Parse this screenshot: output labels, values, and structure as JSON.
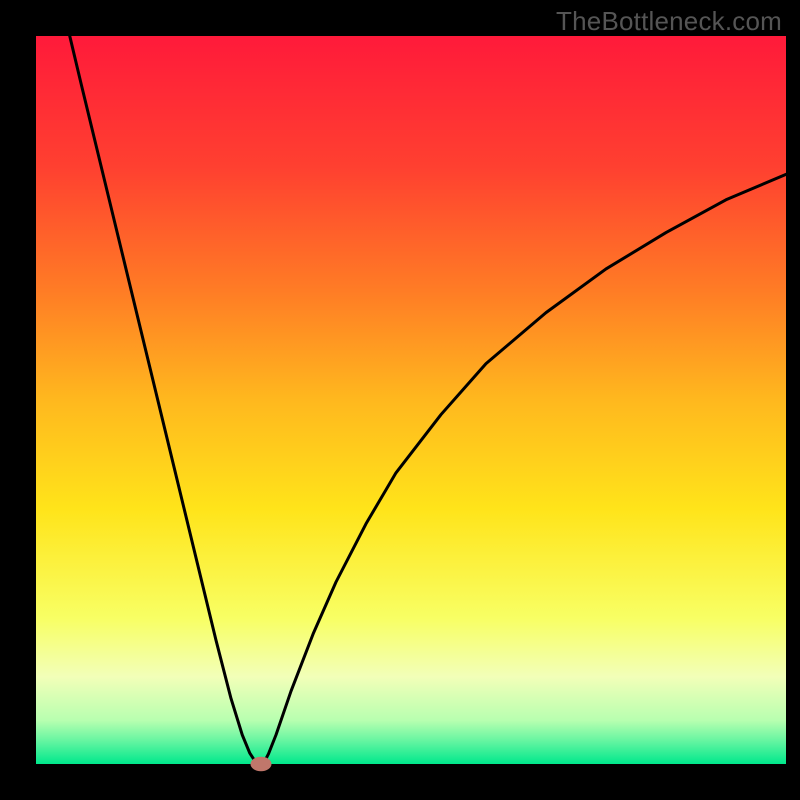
{
  "watermark": "TheBottleneck.com",
  "chart_data": {
    "type": "line",
    "title": "",
    "xlabel": "",
    "ylabel": "",
    "xlim": [
      0,
      100
    ],
    "ylim": [
      0,
      100
    ],
    "grid": false,
    "background": {
      "type": "vertical-gradient",
      "stops": [
        {
          "offset": 0.0,
          "color": "#ff1a3a"
        },
        {
          "offset": 0.18,
          "color": "#ff4030"
        },
        {
          "offset": 0.35,
          "color": "#ff7c25"
        },
        {
          "offset": 0.5,
          "color": "#ffb81e"
        },
        {
          "offset": 0.65,
          "color": "#ffe41a"
        },
        {
          "offset": 0.8,
          "color": "#f8ff64"
        },
        {
          "offset": 0.88,
          "color": "#f2ffb8"
        },
        {
          "offset": 0.94,
          "color": "#b8ffb0"
        },
        {
          "offset": 0.97,
          "color": "#60f4a0"
        },
        {
          "offset": 1.0,
          "color": "#00e88c"
        }
      ]
    },
    "series": [
      {
        "name": "curve",
        "color": "#000000",
        "x": [
          4.5,
          6,
          8,
          10,
          12,
          14,
          16,
          18,
          20,
          22,
          24,
          26,
          27.5,
          28.5,
          29.2,
          29.8,
          30.2,
          30.5,
          31,
          32,
          34,
          37,
          40,
          44,
          48,
          54,
          60,
          68,
          76,
          84,
          92,
          100
        ],
        "values": [
          100,
          93.5,
          85,
          76.5,
          68,
          59.5,
          51,
          42.5,
          34,
          25.5,
          17,
          9,
          4,
          1.5,
          0.4,
          0.1,
          0.1,
          0.4,
          1.4,
          4,
          10,
          18,
          25,
          33,
          40,
          48,
          55,
          62,
          68,
          73,
          77.5,
          81
        ]
      }
    ],
    "marker": {
      "name": "minimum-point",
      "x": 30,
      "y": 0,
      "rx": 1.4,
      "ry": 1.0,
      "color": "#c0776b"
    }
  }
}
